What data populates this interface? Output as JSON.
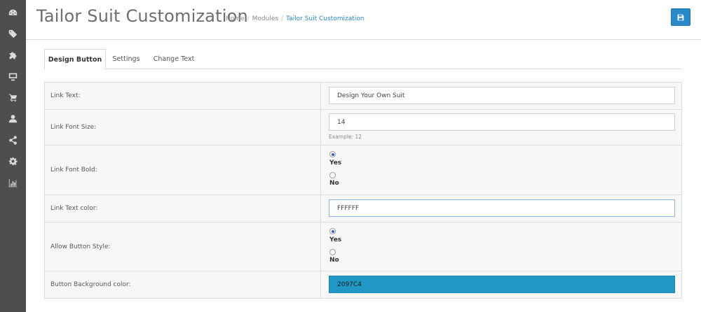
{
  "sidebar": {
    "icons": [
      "dashboard-icon",
      "tags-icon",
      "puzzle-icon",
      "monitor-icon",
      "cart-icon",
      "user-icon",
      "share-icon",
      "gear-icon",
      "bar-chart-icon"
    ]
  },
  "header": {
    "title": "Tailor Suit Customization",
    "breadcrumb": [
      "Home",
      "Modules",
      "Tailor Suit Customization"
    ],
    "save_icon": "save-icon"
  },
  "tabs": [
    {
      "label": "Design Button",
      "active": true
    },
    {
      "label": "Settings",
      "active": false
    },
    {
      "label": "Change Text",
      "active": false
    }
  ],
  "form": {
    "link_text": {
      "label": "Link Text:",
      "value": "Design Your Own Suit"
    },
    "link_font_size": {
      "label": "Link Font Size:",
      "value": "14",
      "help": "Example: 12"
    },
    "link_font_bold": {
      "label": "Link Font Bold:",
      "options": [
        "Yes",
        "No"
      ],
      "selected": "Yes"
    },
    "link_text_color": {
      "label": "Link Text color:",
      "value": "FFFFFF"
    },
    "allow_button_style": {
      "label": "Allow Button Style:",
      "options": [
        "Yes",
        "No"
      ],
      "selected": "Yes"
    },
    "button_bg_color": {
      "label": "Button Background color:",
      "value": "2097C4",
      "color": "#2097C4"
    }
  },
  "colors": {
    "sidebar": "#4e4e4e",
    "accent": "#2a8ac8"
  }
}
